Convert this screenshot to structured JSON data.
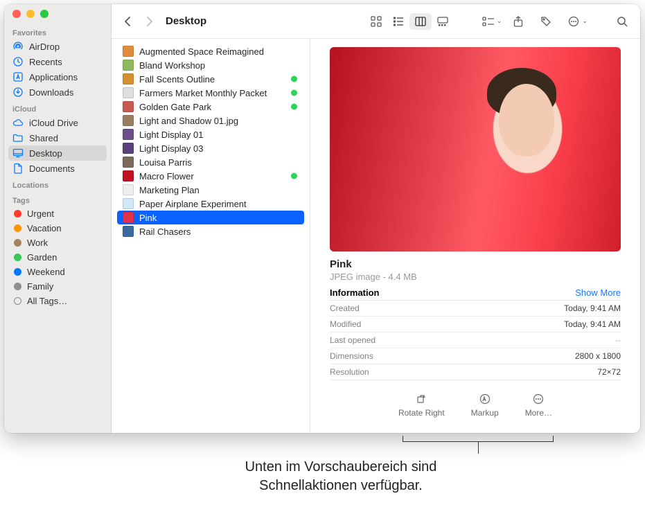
{
  "window": {
    "title": "Desktop"
  },
  "sidebar": {
    "favorites_label": "Favorites",
    "favorites": [
      {
        "label": "AirDrop",
        "icon": "airdrop"
      },
      {
        "label": "Recents",
        "icon": "clock"
      },
      {
        "label": "Applications",
        "icon": "apps"
      },
      {
        "label": "Downloads",
        "icon": "download"
      }
    ],
    "icloud_label": "iCloud",
    "icloud": [
      {
        "label": "iCloud Drive",
        "icon": "cloud"
      },
      {
        "label": "Shared",
        "icon": "folder-shared"
      },
      {
        "label": "Desktop",
        "icon": "desktop",
        "selected": true
      },
      {
        "label": "Documents",
        "icon": "doc"
      }
    ],
    "locations_label": "Locations",
    "tags_label": "Tags",
    "tags": [
      {
        "label": "Urgent",
        "color": "#ff3b30"
      },
      {
        "label": "Vacation",
        "color": "#ff9500"
      },
      {
        "label": "Work",
        "color": "#a2845e"
      },
      {
        "label": "Garden",
        "color": "#34c759"
      },
      {
        "label": "Weekend",
        "color": "#007aff"
      },
      {
        "label": "Family",
        "color": "#8e8e93"
      }
    ],
    "all_tags_label": "All Tags…"
  },
  "files": [
    {
      "label": "Augmented Space Reimagined",
      "icon": "#e28b3e"
    },
    {
      "label": "Bland Workshop",
      "icon": "#8fb85a"
    },
    {
      "label": "Fall Scents Outline",
      "icon": "#d59030",
      "synced": true
    },
    {
      "label": "Farmers Market Monthly Packet",
      "icon": "#dedede",
      "synced": true
    },
    {
      "label": "Golden Gate Park",
      "icon": "#c85a52",
      "synced": true
    },
    {
      "label": "Light and Shadow 01.jpg",
      "icon": "#9a7e62"
    },
    {
      "label": "Light Display 01",
      "icon": "#6b4f8a"
    },
    {
      "label": "Light Display 03",
      "icon": "#5a3f7a"
    },
    {
      "label": "Louisa Parris",
      "icon": "#7a6a5a"
    },
    {
      "label": "Macro Flower",
      "icon": "#c01020",
      "synced": true
    },
    {
      "label": "Marketing Plan",
      "icon": "#eeeeee"
    },
    {
      "label": "Paper Airplane Experiment",
      "icon": "#cfe8f7"
    },
    {
      "label": "Pink",
      "icon": "#e0334a",
      "selected": true
    },
    {
      "label": "Rail Chasers",
      "icon": "#3a6aa0"
    }
  ],
  "preview": {
    "title": "Pink",
    "subtitle": "JPEG image - 4.4 MB",
    "info_label": "Information",
    "show_more": "Show More",
    "rows": [
      {
        "k": "Created",
        "v": "Today, 9:41 AM"
      },
      {
        "k": "Modified",
        "v": "Today, 9:41 AM"
      },
      {
        "k": "Last opened",
        "v": "--",
        "dim": true
      },
      {
        "k": "Dimensions",
        "v": "2800 x 1800"
      },
      {
        "k": "Resolution",
        "v": "72×72"
      }
    ],
    "actions": {
      "rotate": "Rotate Right",
      "markup": "Markup",
      "more": "More…"
    }
  },
  "callout": {
    "line1": "Unten im Vorschaubereich sind",
    "line2": "Schnellaktionen verfügbar."
  }
}
